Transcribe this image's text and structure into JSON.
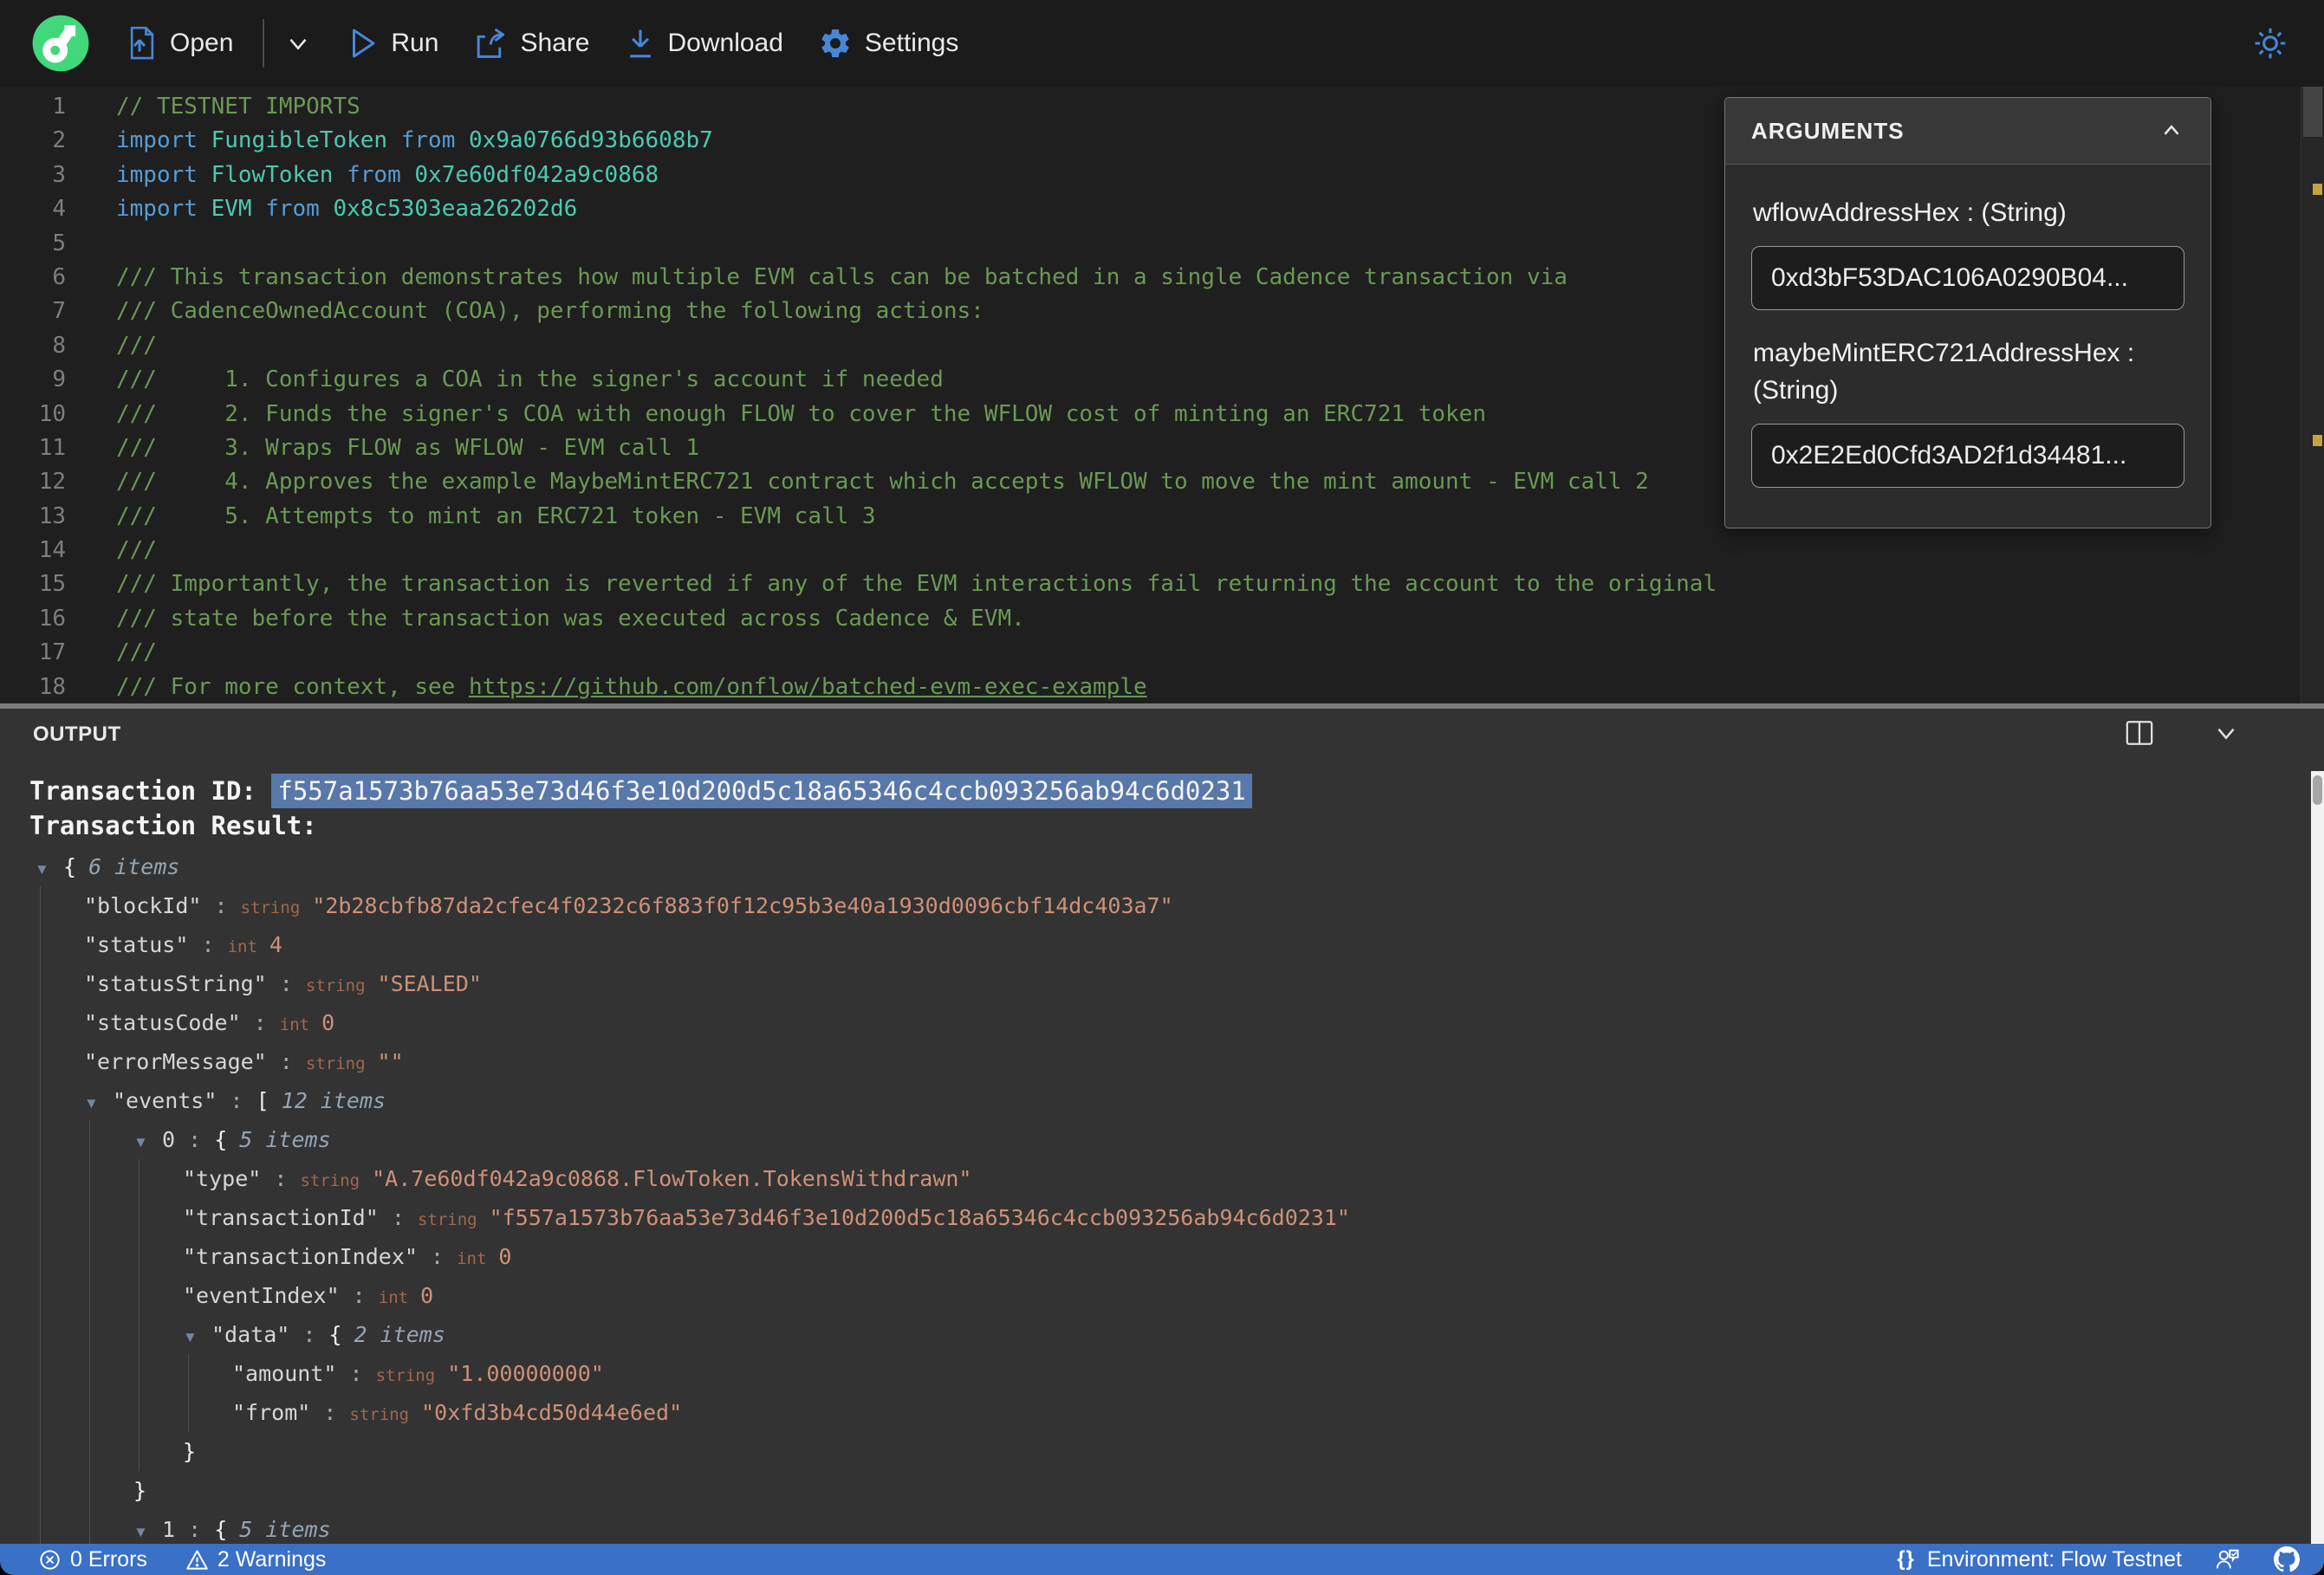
{
  "toolbar": {
    "open": "Open",
    "run": "Run",
    "share": "Share",
    "download": "Download",
    "settings": "Settings"
  },
  "editor": {
    "lines": [
      [
        [
          "c",
          "// TESTNET IMPORTS"
        ]
      ],
      [
        [
          "k",
          "import "
        ],
        [
          "t",
          "FungibleToken "
        ],
        [
          "k",
          "from "
        ],
        [
          "t",
          "0x9a0766d93b6608b7"
        ]
      ],
      [
        [
          "k",
          "import "
        ],
        [
          "t",
          "FlowToken "
        ],
        [
          "k",
          "from "
        ],
        [
          "t",
          "0x7e60df042a9c0868"
        ]
      ],
      [
        [
          "k",
          "import "
        ],
        [
          "t",
          "EVM "
        ],
        [
          "k",
          "from "
        ],
        [
          "t",
          "0x8c5303eaa26202d6"
        ]
      ],
      [],
      [
        [
          "c",
          "/// This transaction demonstrates how multiple EVM calls can be batched in a single Cadence transaction via"
        ]
      ],
      [
        [
          "c",
          "/// CadenceOwnedAccount (COA), performing the following actions:"
        ]
      ],
      [
        [
          "c",
          "///"
        ]
      ],
      [
        [
          "c",
          "///     1. Configures a COA in the signer's account if needed"
        ]
      ],
      [
        [
          "c",
          "///     2. Funds the signer's COA with enough FLOW to cover the WFLOW cost of minting an ERC721 token"
        ]
      ],
      [
        [
          "c",
          "///     3. Wraps FLOW as WFLOW - EVM call 1"
        ]
      ],
      [
        [
          "c",
          "///     4. Approves the example MaybeMintERC721 contract which accepts WFLOW to move the mint amount - EVM call 2"
        ]
      ],
      [
        [
          "c",
          "///     5. Attempts to mint an ERC721 token - EVM call 3"
        ]
      ],
      [
        [
          "c",
          "///"
        ]
      ],
      [
        [
          "c",
          "/// Importantly, the transaction is reverted if any of the EVM interactions fail returning the account to the original"
        ]
      ],
      [
        [
          "c",
          "/// state before the transaction was executed across Cadence & EVM."
        ]
      ],
      [
        [
          "c",
          "///"
        ]
      ],
      [
        [
          "c",
          "/// For more context, see "
        ],
        [
          "u",
          "https://github.com/onflow/batched-evm-exec-example"
        ]
      ]
    ]
  },
  "arguments_panel": {
    "title": "ARGUMENTS",
    "fields": [
      {
        "label": "wflowAddressHex : (String)",
        "value": "0xd3bF53DAC106A0290B04..."
      },
      {
        "label": "maybeMintERC721AddressHex : (String)",
        "value": "0x2E2Ed0Cfd3AD2f1d34481..."
      }
    ]
  },
  "output": {
    "title": "OUTPUT",
    "tx_id_label": "Transaction ID: ",
    "tx_id": "f557a1573b76aa53e73d46f3e10d200d5c18a65346c4ccb093256ab94c6d0231",
    "tx_result_label": "Transaction Result:",
    "tree": [
      {
        "i": 0,
        "tri": 1,
        "open": "{",
        "items": "6 items"
      },
      {
        "i": 1,
        "key": "\"blockId\"",
        "type": "string",
        "val": "\"2b28cbfb87da2cfec4f0232c6f883f0f12c95b3e40a1930d0096cbf14dc403a7\""
      },
      {
        "i": 1,
        "key": "\"status\"",
        "type": "int",
        "val": "4"
      },
      {
        "i": 1,
        "key": "\"statusString\"",
        "type": "string",
        "val": "\"SEALED\""
      },
      {
        "i": 1,
        "key": "\"statusCode\"",
        "type": "int",
        "val": "0"
      },
      {
        "i": 1,
        "key": "\"errorMessage\"",
        "type": "string",
        "val": "\"\""
      },
      {
        "i": 1,
        "tri": 1,
        "key": "\"events\"",
        "open": "[",
        "items": "12 items"
      },
      {
        "i": 2,
        "tri": 1,
        "key": "0",
        "open": "{",
        "items": "5 items"
      },
      {
        "i": 3,
        "key": "\"type\"",
        "type": "string",
        "val": "\"A.7e60df042a9c0868.FlowToken.TokensWithdrawn\""
      },
      {
        "i": 3,
        "key": "\"transactionId\"",
        "type": "string",
        "val": "\"f557a1573b76aa53e73d46f3e10d200d5c18a65346c4ccb093256ab94c6d0231\""
      },
      {
        "i": 3,
        "key": "\"transactionIndex\"",
        "type": "int",
        "val": "0"
      },
      {
        "i": 3,
        "key": "\"eventIndex\"",
        "type": "int",
        "val": "0"
      },
      {
        "i": 3,
        "tri": 1,
        "key": "\"data\"",
        "open": "{",
        "items": "2 items"
      },
      {
        "i": 4,
        "key": "\"amount\"",
        "type": "string",
        "val": "\"1.00000000\""
      },
      {
        "i": 4,
        "key": "\"from\"",
        "type": "string",
        "val": "\"0xfd3b4cd50d44e6ed\""
      },
      {
        "i": 3,
        "close": "}"
      },
      {
        "i": 2,
        "close": "}"
      },
      {
        "i": 2,
        "tri": 1,
        "key": "1",
        "open": "{",
        "items": "5 items"
      }
    ]
  },
  "statusbar": {
    "errors": "0 Errors",
    "warnings": "2 Warnings",
    "env_icon": "{}",
    "env": "Environment: Flow Testnet"
  }
}
